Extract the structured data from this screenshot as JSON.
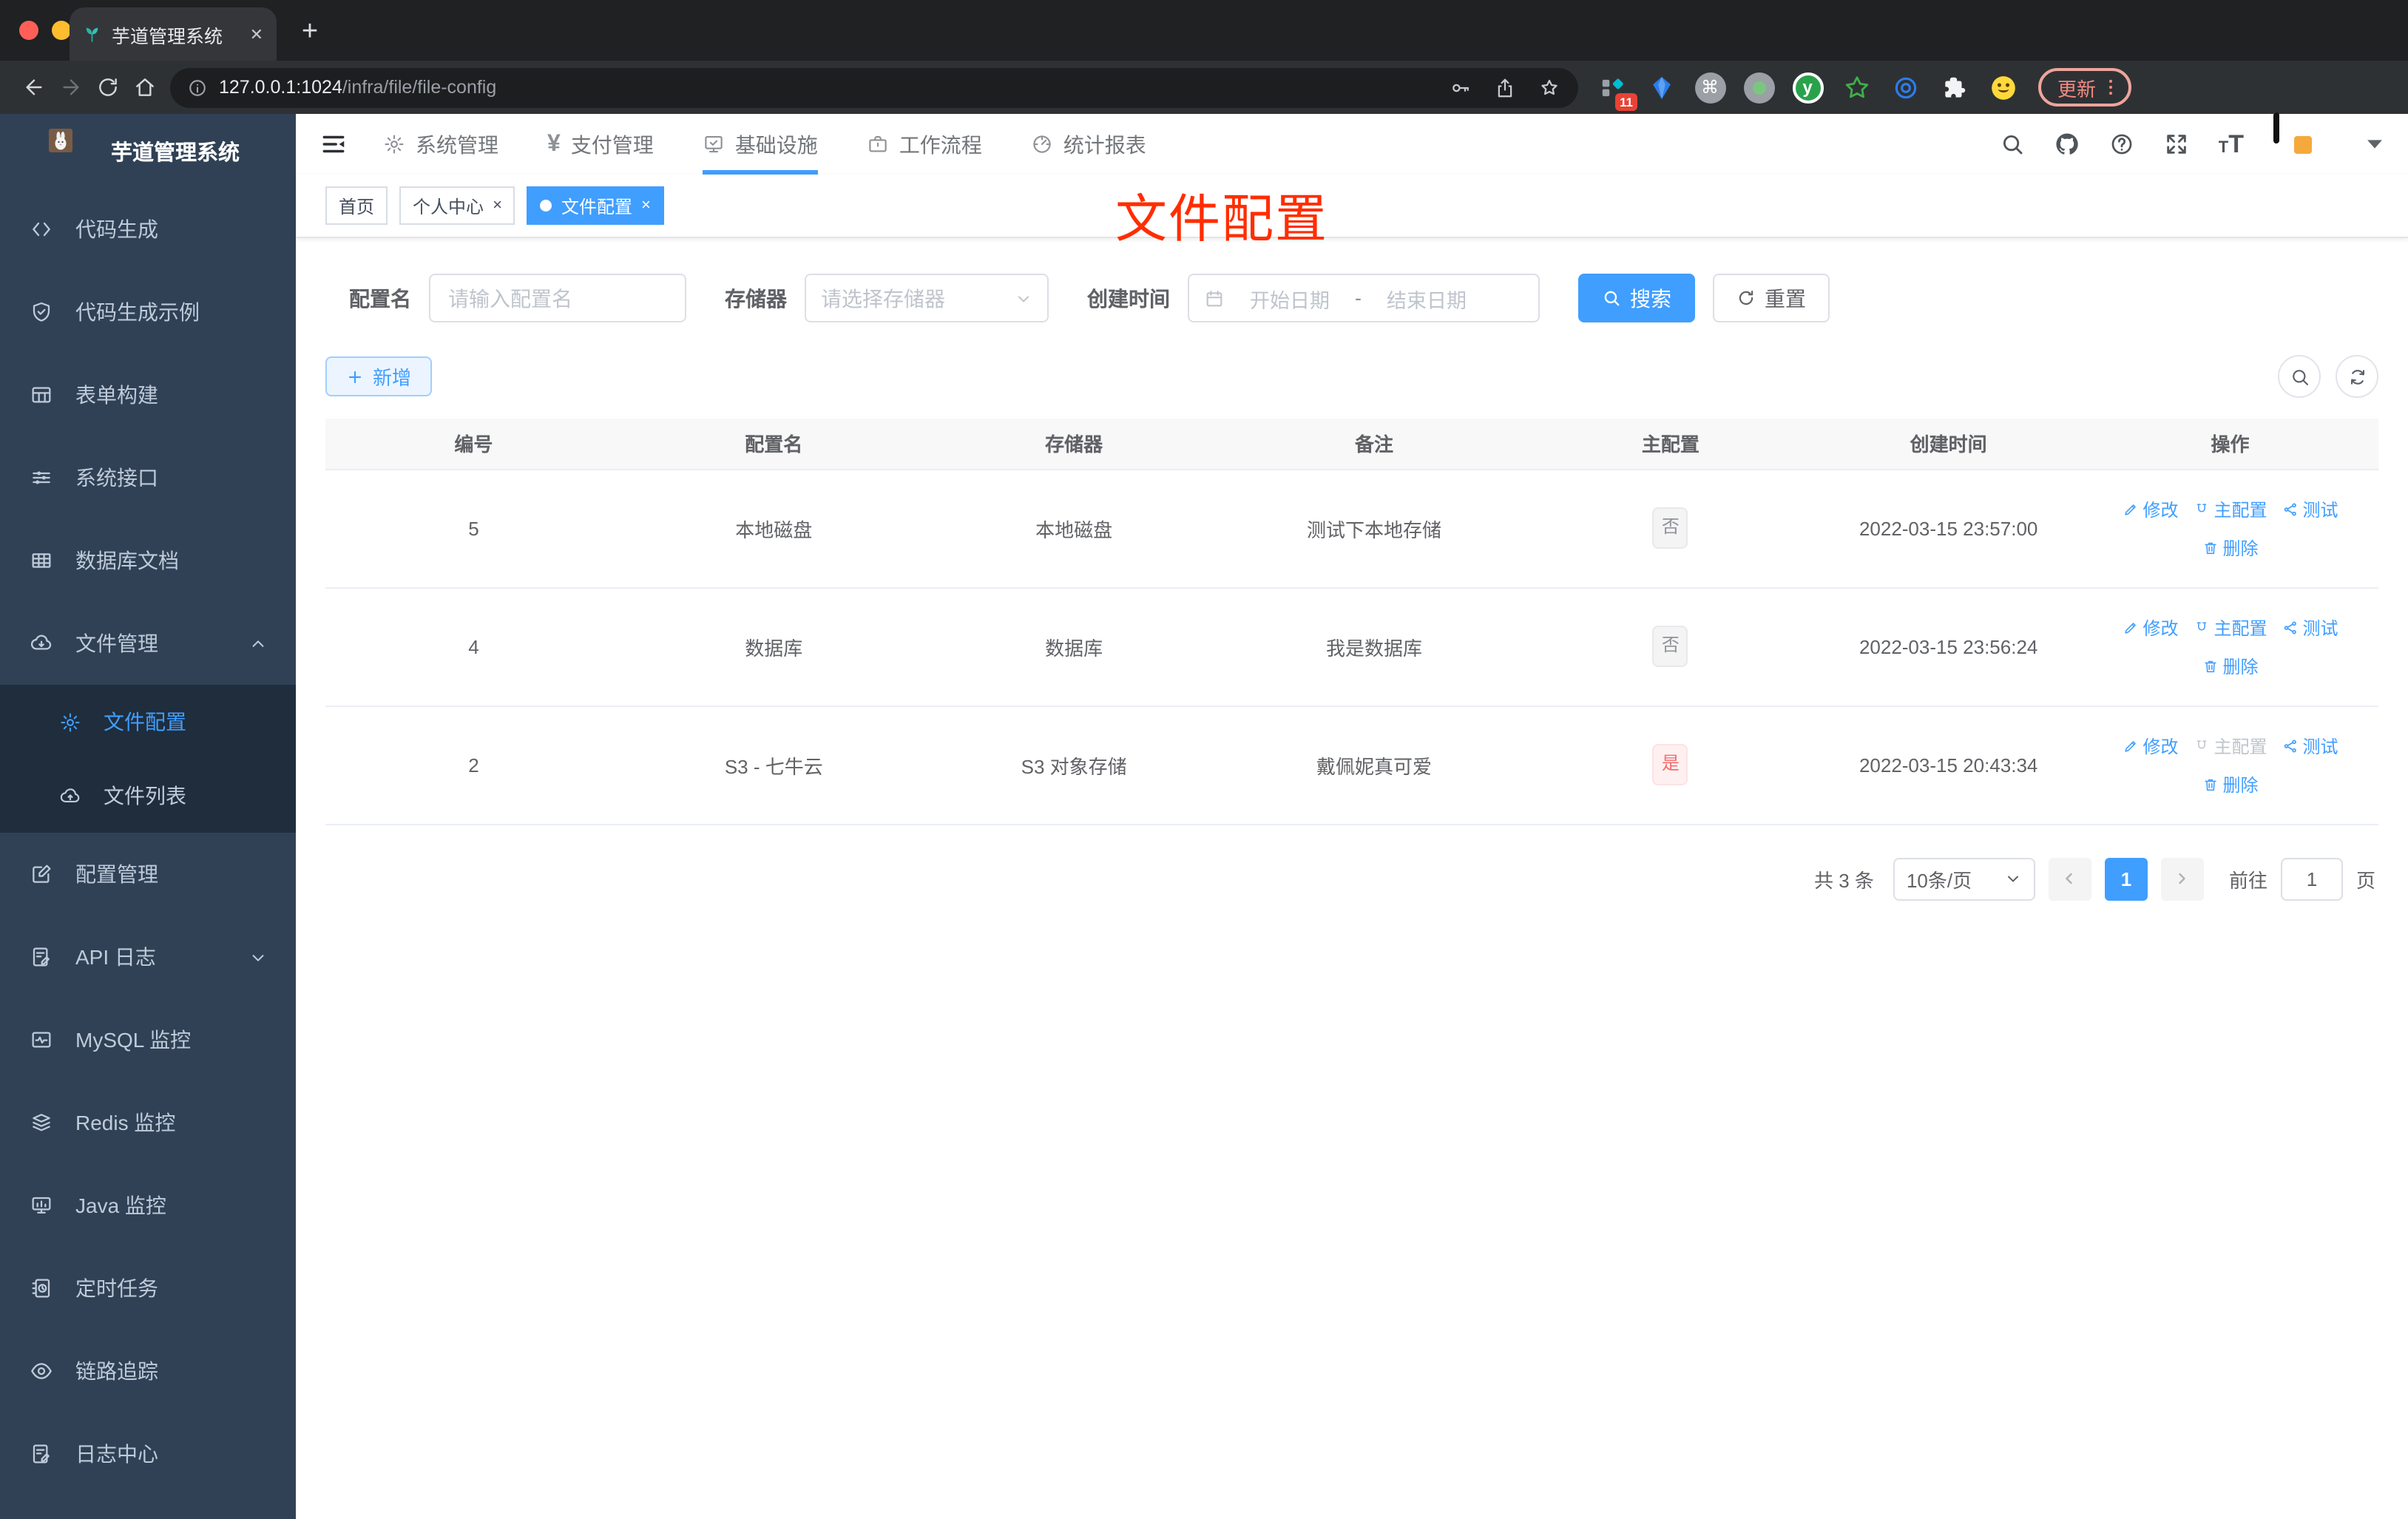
{
  "browser": {
    "tab_title": "芋道管理系统",
    "tab_close": "✕",
    "new_tab": "+",
    "url_host": "127.0.0.1:1024",
    "url_path": "/infra/file/file-config",
    "extension_badge": "11",
    "extensions": [
      "pinned-squares",
      "gem",
      "command",
      "dot",
      "yudao",
      "star",
      "target",
      "puzzle",
      "smiley"
    ],
    "update_button": "更新"
  },
  "sidebar": {
    "title": "芋道管理系统",
    "items": [
      {
        "label": "代码生成",
        "icon": "code-icon"
      },
      {
        "label": "代码生成示例",
        "icon": "shield-check-icon"
      },
      {
        "label": "表单构建",
        "icon": "form-icon"
      },
      {
        "label": "系统接口",
        "icon": "sliders-icon"
      },
      {
        "label": "数据库文档",
        "icon": "grid-icon"
      },
      {
        "label": "文件管理",
        "icon": "cloud-download-icon",
        "expanded": true,
        "children": [
          {
            "label": "文件配置",
            "icon": "gear-icon",
            "active": true
          },
          {
            "label": "文件列表",
            "icon": "cloud-upload-icon"
          }
        ]
      },
      {
        "label": "配置管理",
        "icon": "edit-square-icon"
      },
      {
        "label": "API 日志",
        "icon": "doc-edit-icon",
        "collapsed": true
      },
      {
        "label": "MySQL 监控",
        "icon": "chart-pulse-icon"
      },
      {
        "label": "Redis 监控",
        "icon": "layers-icon"
      },
      {
        "label": "Java 监控",
        "icon": "monitor-bars-icon"
      },
      {
        "label": "定时任务",
        "icon": "timer-icon"
      },
      {
        "label": "链路追踪",
        "icon": "eye-icon"
      },
      {
        "label": "日志中心",
        "icon": "doc-edit-icon"
      }
    ]
  },
  "topnav": {
    "items": [
      {
        "label": "系统管理",
        "icon": "gear-icon"
      },
      {
        "label": "支付管理",
        "icon": "yen-icon"
      },
      {
        "label": "基础设施",
        "icon": "monitor-check-icon",
        "active": true
      },
      {
        "label": "工作流程",
        "icon": "briefcase-icon"
      },
      {
        "label": "统计报表",
        "icon": "dashboard-icon"
      }
    ]
  },
  "tags": [
    {
      "label": "首页"
    },
    {
      "label": "个人中心",
      "closable": true
    },
    {
      "label": "文件配置",
      "closable": true,
      "active": true
    }
  ],
  "tag_close": "×",
  "annotation": {
    "text": "文件配置"
  },
  "filters": {
    "name_label": "配置名",
    "name_placeholder": "请输入配置名",
    "storage_label": "存储器",
    "storage_placeholder": "请选择存储器",
    "date_label": "创建时间",
    "date_start": "开始日期",
    "date_sep": "-",
    "date_end": "结束日期",
    "search": "搜索",
    "reset": "重置"
  },
  "toolbar": {
    "add": "新增"
  },
  "table": {
    "headers": [
      "编号",
      "配置名",
      "存储器",
      "备注",
      "主配置",
      "创建时间",
      "操作"
    ],
    "actions": {
      "edit": "修改",
      "master": "主配置",
      "test": "测试",
      "delete": "删除"
    },
    "rows": [
      {
        "id": "5",
        "name": "本地磁盘",
        "storage": "本地磁盘",
        "remark": "测试下本地存储",
        "master": "否",
        "master_type": "info",
        "time": "2022-03-15 23:57:00",
        "master_disabled": false
      },
      {
        "id": "4",
        "name": "数据库",
        "storage": "数据库",
        "remark": "我是数据库",
        "master": "否",
        "master_type": "info",
        "time": "2022-03-15 23:56:24",
        "master_disabled": false
      },
      {
        "id": "2",
        "name": "S3 - 七牛云",
        "storage": "S3 对象存储",
        "remark": "戴佩妮真可爱",
        "master": "是",
        "master_type": "danger",
        "time": "2022-03-15 20:43:34",
        "master_disabled": true
      }
    ]
  },
  "pagination": {
    "total": "共 3 条",
    "page_size": "10条/页",
    "page": "1",
    "goto": "前往",
    "goto_value": "1",
    "page_suffix": "页"
  },
  "colors": {
    "accent": "#409eff",
    "danger": "#f56c6c",
    "annotation": "#ff2d00",
    "sidebar": "#304156"
  }
}
